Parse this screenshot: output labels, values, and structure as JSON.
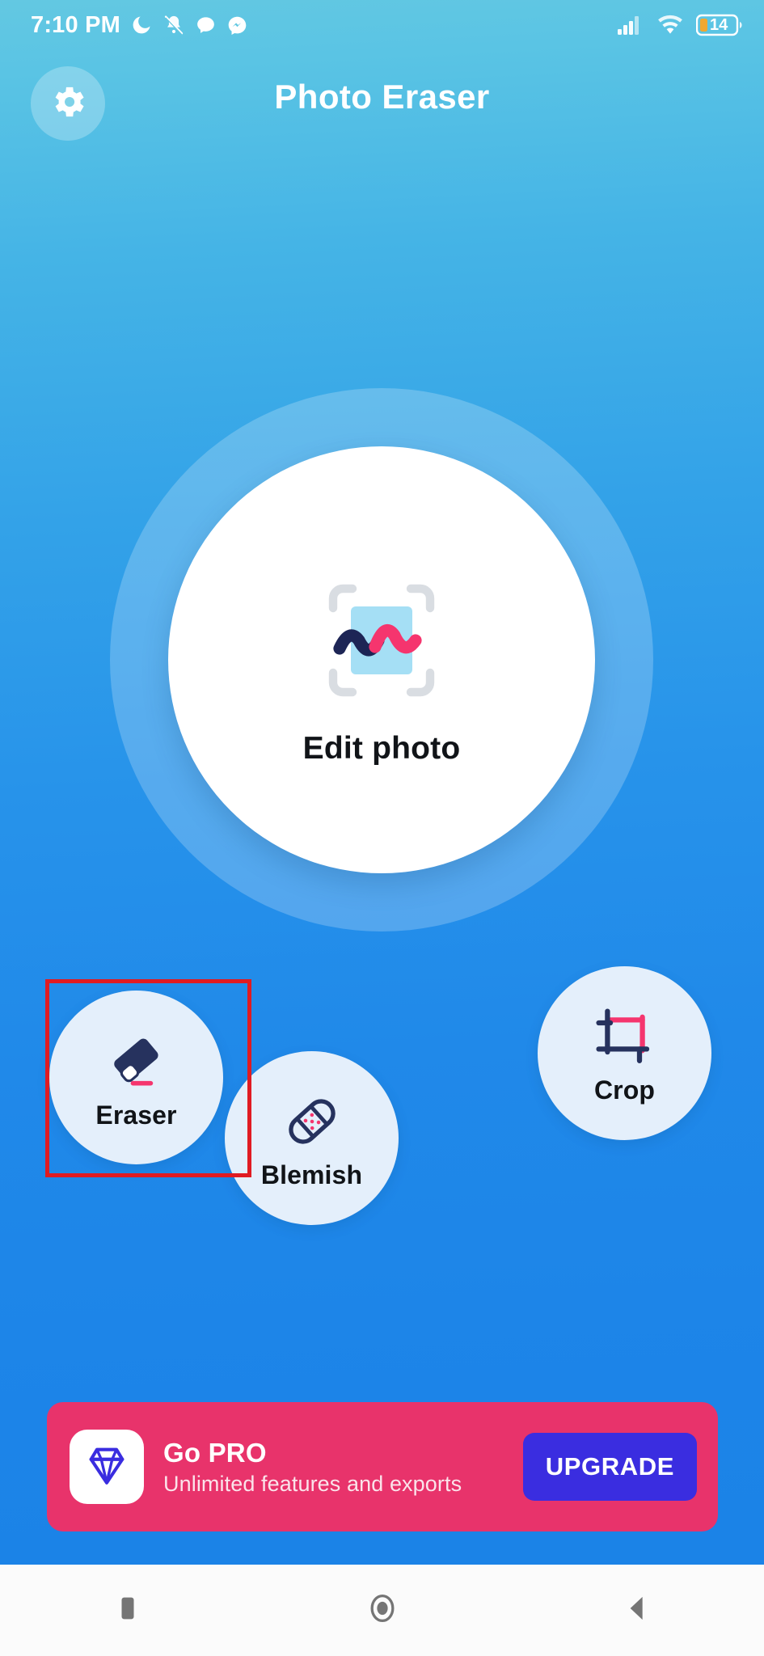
{
  "status_bar": {
    "time": "7:10 PM",
    "left_icons": [
      {
        "name": "do-not-disturb-moon-icon"
      },
      {
        "name": "bell-muted-icon"
      },
      {
        "name": "chat-bubble-icon"
      },
      {
        "name": "messenger-icon"
      }
    ],
    "right_icons": [
      {
        "name": "cellular-signal-icon"
      },
      {
        "name": "wifi-icon"
      }
    ],
    "battery_level": "14"
  },
  "header": {
    "title": "Photo Eraser",
    "settings_icon": "gear-icon"
  },
  "main": {
    "edit_photo": {
      "label": "Edit photo",
      "icon": "photo-scan-squiggle-icon"
    },
    "tools": [
      {
        "id": "eraser",
        "label": "Eraser",
        "icon": "eraser-icon",
        "selected": true
      },
      {
        "id": "blemish",
        "label": "Blemish",
        "icon": "bandage-icon",
        "selected": false
      },
      {
        "id": "crop",
        "label": "Crop",
        "icon": "crop-icon",
        "selected": false
      }
    ]
  },
  "pro_banner": {
    "icon": "diamond-icon",
    "title": "Go PRO",
    "subtitle": "Unlimited features and exports",
    "cta_label": "UPGRADE"
  },
  "nav_bar": {
    "recents": "square-recents-icon",
    "home": "circle-home-icon",
    "back": "triangle-back-icon"
  },
  "colors": {
    "bg_top": "#63c8e2",
    "bg_bottom": "#1b83e7",
    "accent_pink": "#f5356e",
    "accent_navy": "#1d2555",
    "banner_pink": "#e8336b",
    "upgrade_blue": "#3a2de0",
    "selection_red": "#e01b22",
    "tool_circle": "#e4effb",
    "battery_amber": "#f0a830"
  }
}
